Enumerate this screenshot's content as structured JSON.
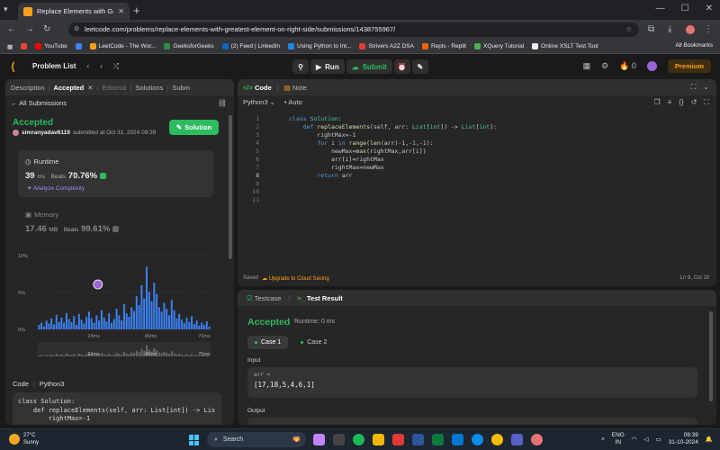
{
  "browser": {
    "tab_title": "Replace Elements with Greatest",
    "url": "leetcode.com/problems/replace-elements-with-greatest-element-on-right-side/submissions/1438755967/",
    "bookmarks": [
      {
        "label": "YouTube",
        "color": "#ff0000"
      },
      {
        "label": "",
        "color": "#3b82f6"
      },
      {
        "label": "LeetCode - The Wor...",
        "color": "#ffa116"
      },
      {
        "label": "GeeksforGeeks",
        "color": "#2f8d46"
      },
      {
        "label": "(2) Feed | LinkedIn",
        "color": "#0a66c2"
      },
      {
        "label": "Using Python to Int...",
        "color": "#1e88e5"
      },
      {
        "label": "Strivers A2Z DSA",
        "color": "#e53935"
      },
      {
        "label": "Repls - Replit",
        "color": "#f26207"
      },
      {
        "label": "XQuery Tutorial",
        "color": "#4caf50"
      },
      {
        "label": "Online XSLT Test Tool",
        "color": "#eeeeee"
      }
    ],
    "all_bookmarks": "All Bookmarks"
  },
  "nav": {
    "problem_list": "Problem List",
    "run": "Run",
    "submit": "Submit",
    "streak": "0",
    "premium": "Premium"
  },
  "left": {
    "tabs": [
      "Description",
      "Accepted",
      "Editorial",
      "Solutions",
      "Subm"
    ],
    "all_submissions": "All Submissions",
    "status": "Accepted",
    "username": "simranyadav6119",
    "submitted_at": "submitted at Oct 31, 2024 09:39",
    "solution_button": "Solution",
    "runtime": {
      "label": "Runtime",
      "value": "39",
      "unit": "ms",
      "beats_label": "Beats",
      "beats": "70.76%"
    },
    "analyze": "Analyze Complexity",
    "memory": {
      "label": "Memory",
      "value": "17.46",
      "unit": "MB",
      "beats_label": "Beats",
      "beats": "99.61%"
    },
    "code_label": "Code",
    "code_lang": "Python3",
    "code_snippet": "class Solution:\n    def replaceElements(self, arr: List[int]) -> Lis\n        rightMax=-1"
  },
  "chart_data": {
    "type": "bar",
    "title": "",
    "ylabel": "",
    "ytick_labels": [
      "10%",
      "5%",
      "0%"
    ],
    "ylim": [
      0,
      10
    ],
    "xtick_labels": [
      "24ms",
      "46ms",
      "70ms"
    ],
    "highlight_bin": "39ms",
    "values": [
      0.6,
      0.9,
      0.4,
      1.2,
      0.8,
      1.5,
      0.7,
      2.0,
      1.0,
      1.6,
      0.9,
      2.2,
      1.4,
      1.0,
      1.8,
      0.6,
      2.1,
      1.3,
      0.8,
      1.7,
      2.4,
      1.5,
      0.9,
      1.9,
      1.2,
      2.6,
      1.6,
      1.1,
      2.2,
      0.9,
      1.4,
      2.8,
      1.9,
      1.2,
      3.4,
      2.2,
      1.7,
      3.0,
      2.5,
      4.5,
      3.3,
      6.0,
      4.2,
      8.5,
      5.1,
      3.8,
      6.3,
      4.8,
      3.0,
      2.4,
      3.6,
      2.8,
      1.9,
      4.0,
      2.6,
      1.5,
      2.1,
      1.3,
      0.9,
      1.6,
      1.0,
      1.8,
      0.7,
      1.2,
      0.5,
      0.9,
      0.6,
      1.1,
      0.4
    ]
  },
  "editor": {
    "tab_code": "Code",
    "tab_note": "Note",
    "language": "Python3",
    "auto": "Auto",
    "line_numbers": [
      "1",
      "2",
      "3",
      "4",
      "5",
      "6",
      "7",
      "8",
      "9",
      "10",
      "11"
    ],
    "status_saved": "Saved",
    "upgrade": "Upgrade to Cloud Saving",
    "cursor": "Ln 8, Col 19"
  },
  "test": {
    "tab_testcase": "Testcase",
    "tab_result": "Test Result",
    "status": "Accepted",
    "runtime": "Runtime: 0 ms",
    "cases": [
      "Case 1",
      "Case 2"
    ],
    "input_label": "Input",
    "var": "arr =",
    "value": "[17,18,5,4,6,1]",
    "output_label": "Output"
  },
  "taskbar": {
    "temp": "27°C",
    "weather": "Sunny",
    "search": "Search",
    "lang1": "ENG",
    "lang2": "IN",
    "time": "09:39",
    "date": "31-10-2024"
  }
}
